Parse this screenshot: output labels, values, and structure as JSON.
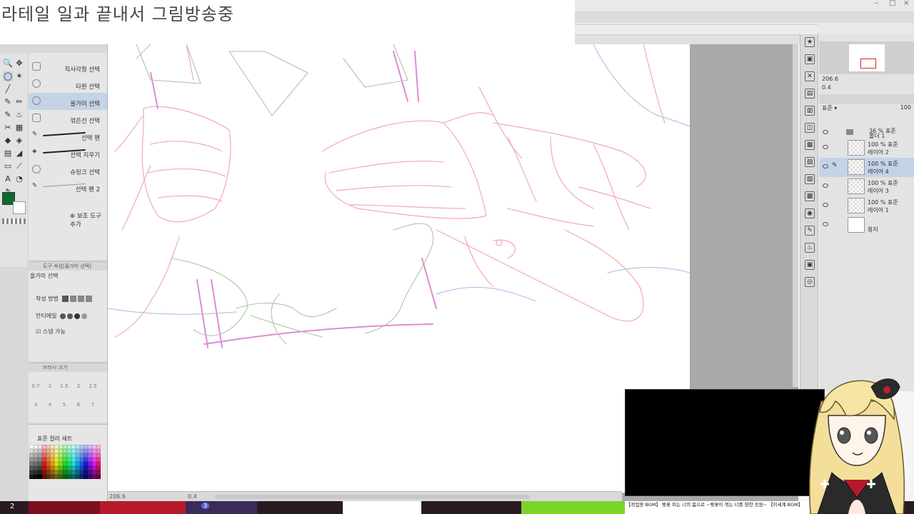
{
  "stream": {
    "title": "라테일 일과 끝내서 그림방송중",
    "ticker": "【작업용 BGM】 벚꽃 피는 너의 봄으로 ~벚꽃이 꺾는 너를 향한 응원~ 【이세계 BGM】"
  },
  "tools": {
    "subtools": [
      {
        "label": "직사각형 선택"
      },
      {
        "label": "타원 선택"
      },
      {
        "label": "올가미 선택"
      },
      {
        "label": "꺾은선 선택"
      },
      {
        "label": "선택 펜"
      },
      {
        "label": "선택 지우기"
      },
      {
        "label": "슈링크 선택"
      },
      {
        "label": "선택 펜 2"
      }
    ],
    "add_subtool": "보조 도구 추가",
    "main_color": "#0a6b2d"
  },
  "tool_property": {
    "header": "도구 속성[올가미 선택]",
    "title": "올가미 선택",
    "creation_method_label": "작성 방법",
    "antialias_label": "안티에일",
    "snap_label": "스냅 가능"
  },
  "brush_size": {
    "header": "브러시 크기",
    "sizes": [
      "0.7",
      "1",
      "1.5",
      "2",
      "2.5",
      "3",
      "4",
      "5",
      "6",
      "7"
    ]
  },
  "palette": {
    "title": "표준 컬러 세트"
  },
  "navigator": {
    "zoom": "206.6",
    "rotation": "0.4"
  },
  "layers": {
    "blend_mode": "표준",
    "opacity": "100",
    "folder": {
      "line1": "36 % 표준",
      "line2": "폴더 1"
    },
    "items": [
      {
        "line1": "100 % 표준",
        "line2": "레이어 2",
        "active": false
      },
      {
        "line1": "100 % 표준",
        "line2": "레이어 4",
        "active": true
      },
      {
        "line1": "100 % 표준",
        "line2": "레이어 3",
        "active": false
      },
      {
        "line1": "100 % 표준",
        "line2": "레이어 1",
        "active": false
      },
      {
        "line1": "",
        "line2": "용지",
        "active": false
      }
    ]
  },
  "status": {
    "zoom": "206.6",
    "rotation": "0.4"
  },
  "taskbar": {
    "left_number": "2",
    "badge_number": "3"
  }
}
